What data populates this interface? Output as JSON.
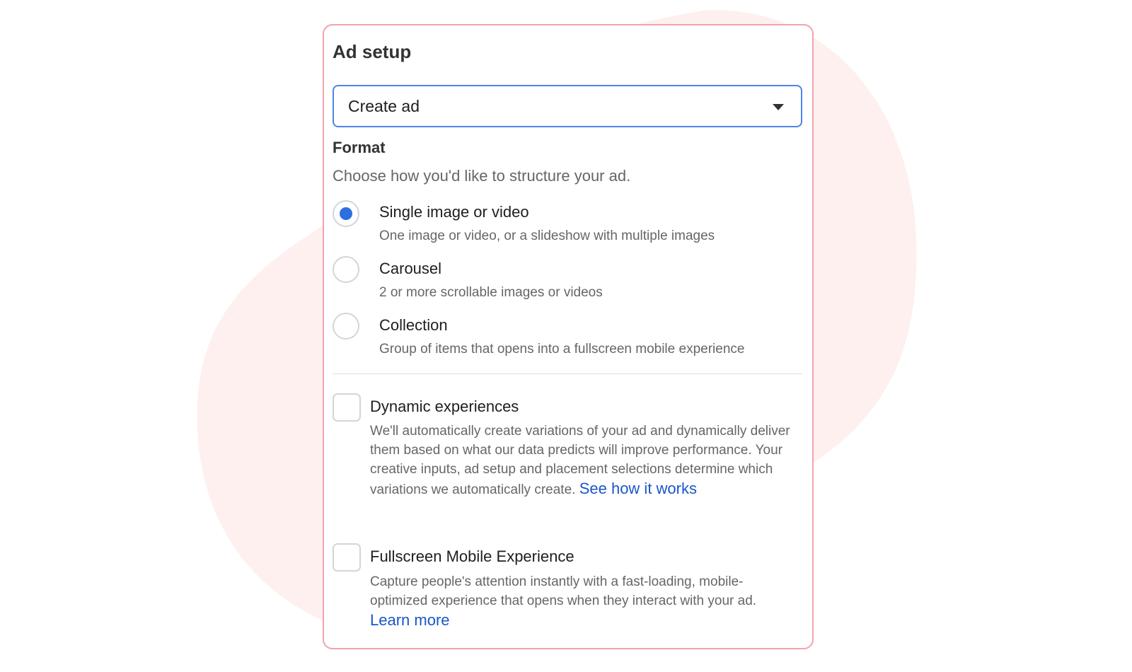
{
  "panel": {
    "title": "Ad setup",
    "select": {
      "value": "Create ad"
    }
  },
  "format": {
    "title": "Format",
    "description": "Choose how you'd like to structure your ad.",
    "options": [
      {
        "label": "Single image or video",
        "description": "One image or video, or a slideshow with multiple images",
        "selected": true
      },
      {
        "label": "Carousel",
        "description": "2 or more scrollable images or videos",
        "selected": false
      },
      {
        "label": "Collection",
        "description": "Group of items that opens into a fullscreen mobile experience",
        "selected": false
      }
    ]
  },
  "dynamic": {
    "label": "Dynamic experiences",
    "description": "We'll automatically create variations of your ad and dynamically deliver them based on what our data predicts will improve performance. Your creative inputs, ad setup and placement selections determine which variations we automatically create.",
    "link": "See how it works",
    "checked": false
  },
  "fullscreen": {
    "label": "Fullscreen Mobile Experience",
    "description": "Capture people's attention instantly with a fast-loading, mobile-optimized experience that opens when they interact with your ad.",
    "link": "Learn more",
    "checked": false
  },
  "colors": {
    "card_border": "#f3a3ae",
    "select_border": "#4a86e8",
    "radio_selected": "#2d6fe0",
    "link": "#1a56c9",
    "blob": "#fdf0ef"
  }
}
